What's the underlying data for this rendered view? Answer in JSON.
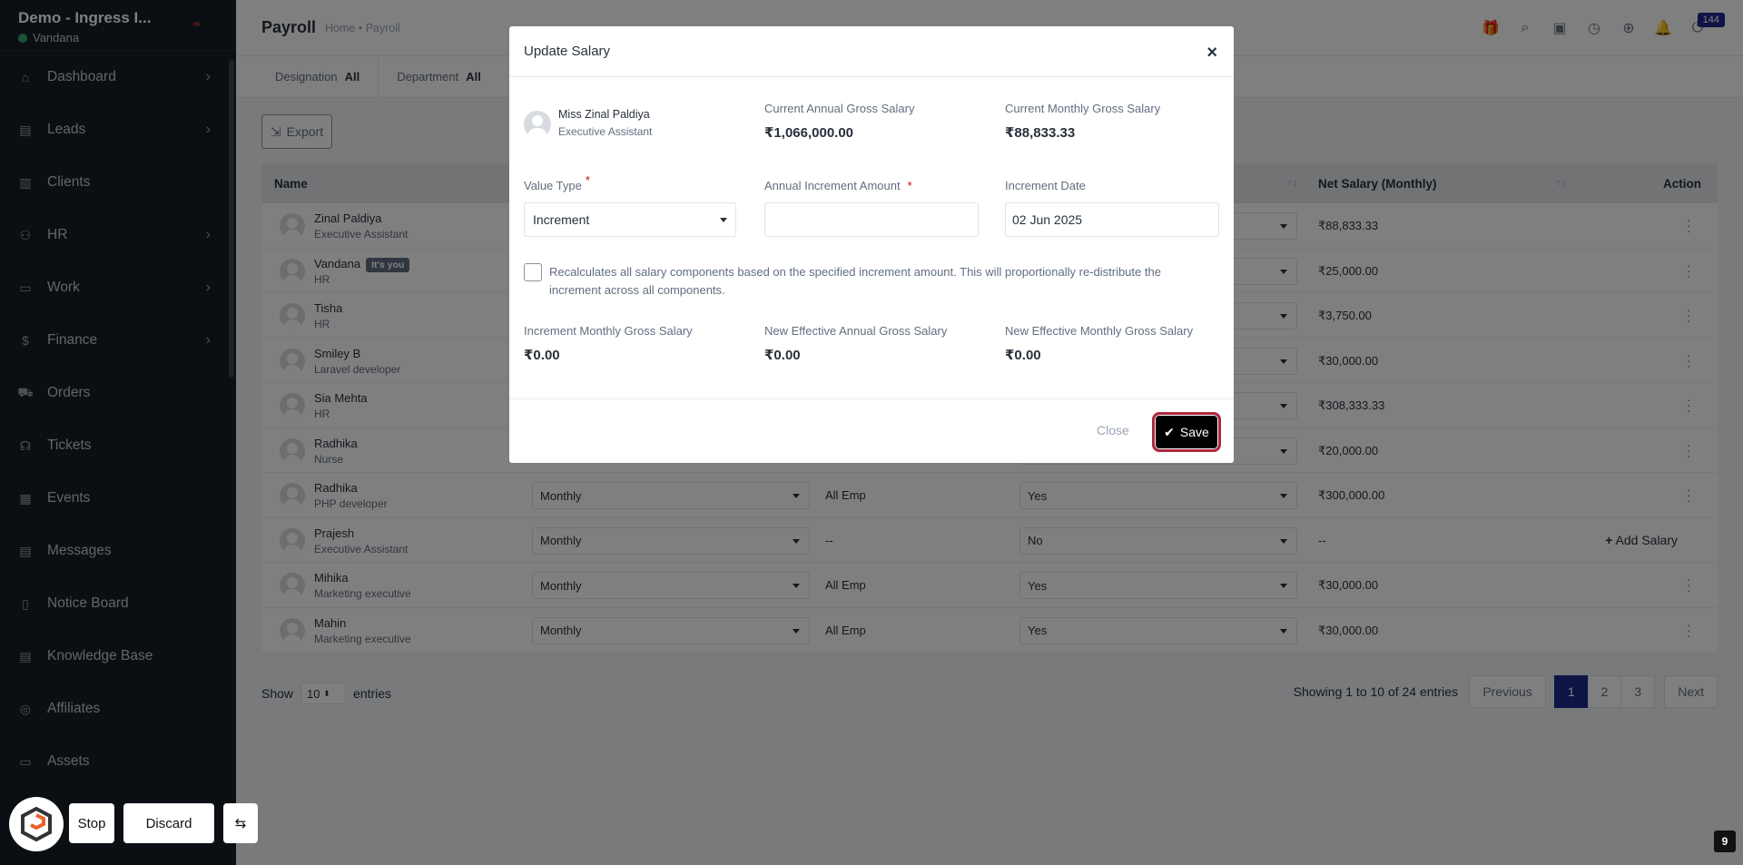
{
  "sidebar": {
    "company": "Demo - Ingress I...",
    "user": "Vandana",
    "flag": "IN",
    "items": [
      {
        "label": "Dashboard",
        "icon": "dashboard-icon",
        "chevron": true
      },
      {
        "label": "Leads",
        "icon": "leads-icon",
        "chevron": true
      },
      {
        "label": "Clients",
        "icon": "clients-icon",
        "chevron": false
      },
      {
        "label": "HR",
        "icon": "hr-icon",
        "chevron": true
      },
      {
        "label": "Work",
        "icon": "work-icon",
        "chevron": true
      },
      {
        "label": "Finance",
        "icon": "finance-icon",
        "chevron": true
      },
      {
        "label": "Orders",
        "icon": "orders-icon",
        "chevron": false
      },
      {
        "label": "Tickets",
        "icon": "tickets-icon",
        "chevron": false
      },
      {
        "label": "Events",
        "icon": "events-icon",
        "chevron": false
      },
      {
        "label": "Messages",
        "icon": "messages-icon",
        "chevron": false
      },
      {
        "label": "Notice Board",
        "icon": "notice-board-icon",
        "chevron": false
      },
      {
        "label": "Knowledge Base",
        "icon": "knowledge-base-icon",
        "chevron": false
      },
      {
        "label": "Affiliates",
        "icon": "affiliates-icon",
        "chevron": false
      },
      {
        "label": "Assets",
        "icon": "assets-icon",
        "chevron": false
      }
    ]
  },
  "header": {
    "title": "Payroll",
    "breadcrumb": "Home • Payroll",
    "notification_count": "144"
  },
  "filters": {
    "designation_label": "Designation",
    "designation_value": "All",
    "department_label": "Department",
    "department_value": "All"
  },
  "toolbar": {
    "export_label": "Export"
  },
  "table": {
    "col_name": "Name",
    "col_net": "Net Salary (Monthly)",
    "col_action": "Action",
    "its_you": "It's you",
    "add_salary": "Add Salary",
    "rows": [
      {
        "name": "Zinal Paldiya",
        "role": "Executive Assistant",
        "cycle": "",
        "type": "",
        "allow": "",
        "net": "₹88,833.33"
      },
      {
        "name": "Vandana",
        "role": "HR",
        "cycle": "",
        "type": "",
        "allow": "",
        "net": "₹25,000.00"
      },
      {
        "name": "Tisha",
        "role": "HR",
        "cycle": "",
        "type": "",
        "allow": "",
        "net": "₹3,750.00"
      },
      {
        "name": "Smiley B",
        "role": "Laravel developer",
        "cycle": "",
        "type": "",
        "allow": "",
        "net": "₹30,000.00"
      },
      {
        "name": "Sia Mehta",
        "role": "HR",
        "cycle": "",
        "type": "",
        "allow": "",
        "net": "₹308,333.33"
      },
      {
        "name": "Radhika",
        "role": "Nurse",
        "cycle": "",
        "type": "",
        "allow": "",
        "net": "₹20,000.00"
      },
      {
        "name": "Radhika",
        "role": "PHP developer",
        "cycle": "Monthly",
        "type": "All Emp",
        "allow": "Yes",
        "net": "₹300,000.00"
      },
      {
        "name": "Prajesh",
        "role": "Executive Assistant",
        "cycle": "Monthly",
        "type": "--",
        "allow": "No",
        "net": "--"
      },
      {
        "name": "Mihika",
        "role": "Marketing executive",
        "cycle": "Monthly",
        "type": "All Emp",
        "allow": "Yes",
        "net": "₹30,000.00"
      },
      {
        "name": "Mahin",
        "role": "Marketing executive",
        "cycle": "Monthly",
        "type": "All Emp",
        "allow": "Yes",
        "net": "₹30,000.00"
      }
    ]
  },
  "footer": {
    "show": "Show",
    "entries_value": "10",
    "entries": "entries",
    "showing": "Showing 1 to 10 of 24 entries",
    "prev": "Previous",
    "pages": [
      "1",
      "2",
      "3"
    ],
    "next": "Next"
  },
  "modal": {
    "title": "Update Salary",
    "employee_name": "Miss Zinal Paldiya",
    "employee_role": "Executive Assistant",
    "current_annual_label": "Current Annual Gross Salary",
    "current_annual_value": "₹1,066,000.00",
    "current_monthly_label": "Current Monthly Gross Salary",
    "current_monthly_value": "₹88,833.33",
    "value_type_label": "Value Type",
    "value_type_value": "Increment",
    "annual_increment_label": "Annual Increment Amount",
    "annual_increment_value": "",
    "increment_date_label": "Increment Date",
    "increment_date_value": "02 Jun 2025",
    "recalc_text": "Recalculates all salary components based on the specified increment amount. This will proportionally re-distribute the increment across all components.",
    "inc_monthly_label": "Increment Monthly Gross Salary",
    "inc_monthly_value": "₹0.00",
    "new_annual_label": "New Effective Annual Gross Salary",
    "new_annual_value": "₹0.00",
    "new_monthly_label": "New Effective Monthly Gross Salary",
    "new_monthly_value": "₹0.00",
    "close_label": "Close",
    "save_label": "Save"
  },
  "controls": {
    "stop": "Stop",
    "discard": "Discard",
    "corner_badge": "9"
  }
}
